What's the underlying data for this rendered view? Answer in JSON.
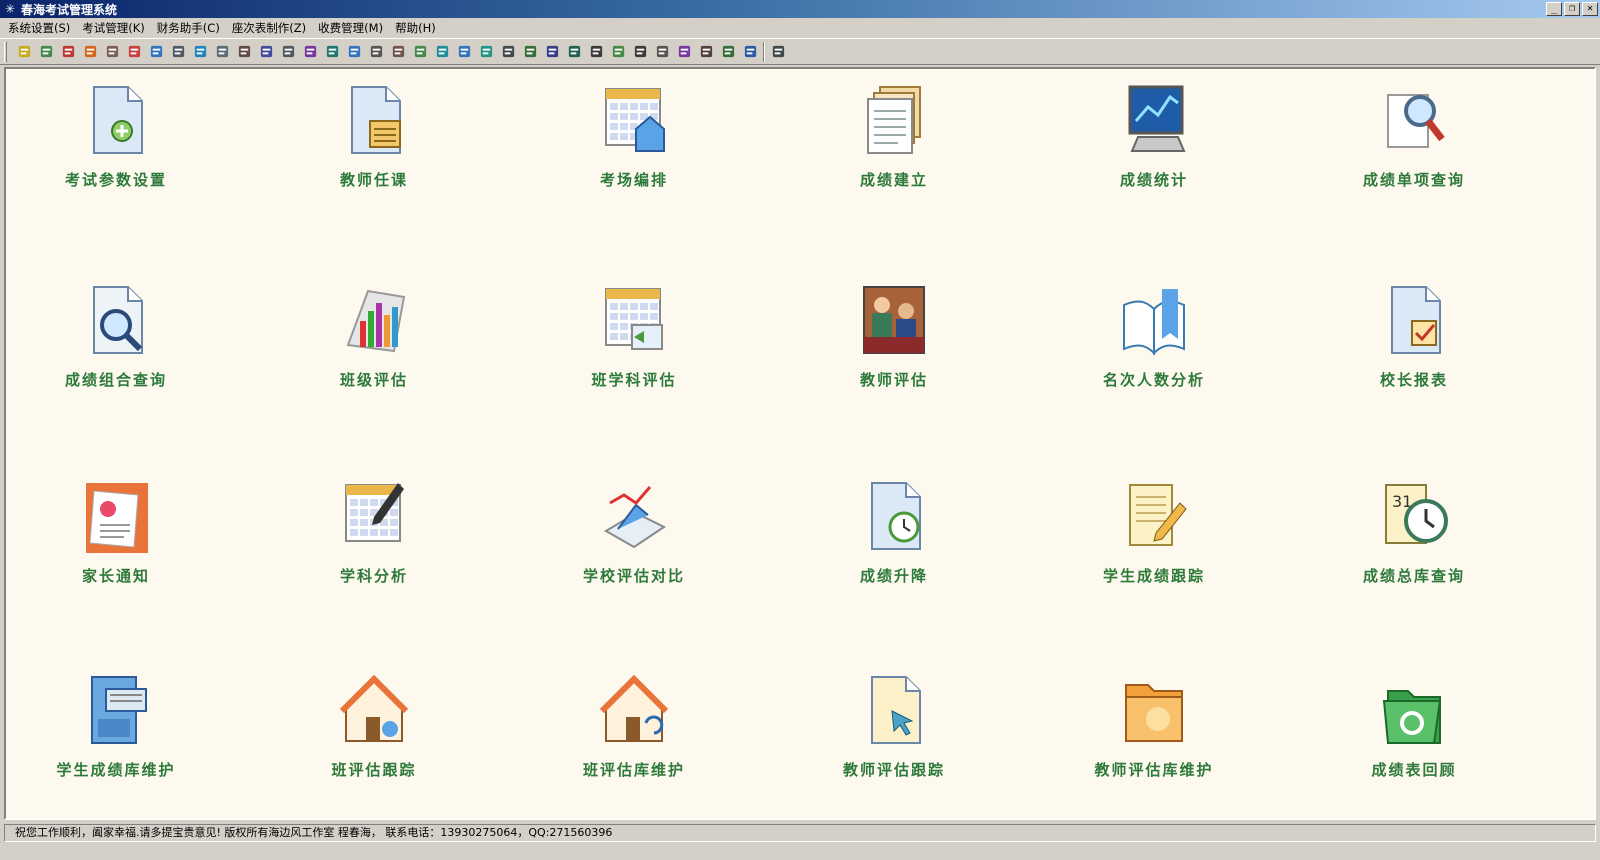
{
  "window": {
    "title": "春海考试管理系统"
  },
  "menu": [
    "系统设置(S)",
    "考试管理(K)",
    "财务助手(C)",
    "座次表制作(Z)",
    "收费管理(M)",
    "帮助(H)"
  ],
  "toolbar_icons": [
    "key-icon",
    "image-icon",
    "scissors-icon",
    "folder-open-icon",
    "person-search-icon",
    "shield-icon",
    "edit-icon",
    "report-icon",
    "zoom-doc-icon",
    "magnify-icon",
    "grid-doc-icon",
    "columns-icon",
    "table-icon",
    "line-chart-icon",
    "copy-icon",
    "chart-icon",
    "list-icon",
    "pages-icon",
    "bar-chart-icon",
    "export-icon",
    "import-icon",
    "database-icon",
    "dots-grid-icon",
    "search-icon",
    "spreadsheet-icon",
    "disc-icon",
    "align-icon",
    "check-doc-icon",
    "lines-icon",
    "form-icon",
    "book-icon",
    "camera-icon",
    "calculator-icon",
    "target-icon",
    "exit-door-icon"
  ],
  "tiles": [
    {
      "label": "考试参数设置",
      "icon": "doc-settings-icon"
    },
    {
      "label": "教师任课",
      "icon": "doc-calendar-icon"
    },
    {
      "label": "考场编排",
      "icon": "calendar-house-icon"
    },
    {
      "label": "成绩建立",
      "icon": "doc-stack-icon"
    },
    {
      "label": "成绩统计",
      "icon": "monitor-chart-icon"
    },
    {
      "label": "成绩单项查询",
      "icon": "doc-magnifier-icon"
    },
    {
      "label": "成绩组合查询",
      "icon": "doc-lens-icon"
    },
    {
      "label": "班级评估",
      "icon": "bar-chart-book-icon"
    },
    {
      "label": "班学科评估",
      "icon": "calendar-arrow-icon"
    },
    {
      "label": "教师评估",
      "icon": "people-photo-icon"
    },
    {
      "label": "名次人数分析",
      "icon": "open-book-icon"
    },
    {
      "label": "校长报表",
      "icon": "doc-check-icon"
    },
    {
      "label": "家长通知",
      "icon": "letter-seal-icon"
    },
    {
      "label": "学科分析",
      "icon": "calendar-pen-icon"
    },
    {
      "label": "学校评估对比",
      "icon": "line-chart-3d-icon"
    },
    {
      "label": "成绩升降",
      "icon": "doc-clock-icon"
    },
    {
      "label": "学生成绩跟踪",
      "icon": "notepad-pencil-icon"
    },
    {
      "label": "成绩总库查询",
      "icon": "calendar-clock-icon"
    },
    {
      "label": "学生成绩库维护",
      "icon": "file-cabinet-icon"
    },
    {
      "label": "班评估跟踪",
      "icon": "house-arrow-icon"
    },
    {
      "label": "班评估库维护",
      "icon": "house-refresh-icon"
    },
    {
      "label": "教师评估跟踪",
      "icon": "doc-cursor-icon"
    },
    {
      "label": "教师评估库维护",
      "icon": "orange-folder-icon"
    },
    {
      "label": "成绩表回顾",
      "icon": "green-folder-icon"
    }
  ],
  "status": {
    "text": "祝您工作顺利，阖家幸福.请多提宝贵意见!  版权所有海边风工作室 程春海， 联系电话：13930275064，QQ:271560396"
  }
}
